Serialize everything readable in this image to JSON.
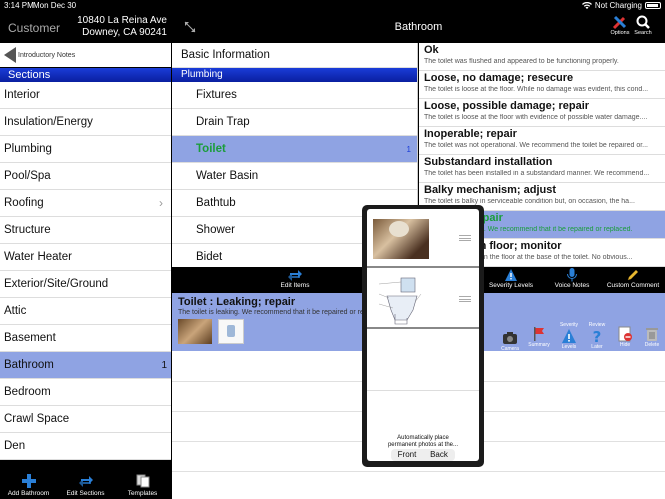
{
  "status": {
    "time": "3:14 PM",
    "date": "Mon Dec 30",
    "charging": "Not Charging"
  },
  "left": {
    "customer": "Customer",
    "address_line1": "10840 La Reina Ave",
    "address_line2": "Downey, CA 90241",
    "intro_notes": "Introductory Notes",
    "sections_header": "Sections",
    "sections": [
      "Interior",
      "Insulation/Energy",
      "Plumbing",
      "Pool/Spa",
      "Roofing",
      "Structure",
      "Water Heater",
      "Exterior/Site/Ground",
      "Attic",
      "Basement",
      "Bathroom",
      "Bedroom",
      "Crawl Space",
      "Den"
    ],
    "bathroom_count": "1",
    "toolbar": {
      "add": "Add Bathroom",
      "edit": "Edit Sections",
      "templates": "Templates"
    }
  },
  "header": {
    "title": "Bathroom",
    "options": "Options",
    "search": "Search"
  },
  "subsections": {
    "basic_info": "Basic Information",
    "group": "Plumbing",
    "items": [
      "Fixtures",
      "Drain Trap",
      "Toilet",
      "Water Basin",
      "Bathtub",
      "Shower",
      "Bidet"
    ],
    "toilet_count": "1"
  },
  "comments": [
    {
      "title": "Ok",
      "desc": "The toilet was flushed and appeared to be functioning properly."
    },
    {
      "title": "Loose, no damage; resecure",
      "desc": "The toilet is loose at the floor. While no damage was evident, this cond..."
    },
    {
      "title": "Loose, possible damage; repair",
      "desc": "The toilet is loose at the floor with evidence of possible water damage...."
    },
    {
      "title": "Inoperable; repair",
      "desc": "The toilet was not operational. We recommend the toilet be repaired or..."
    },
    {
      "title": "Substandard installation",
      "desc": "The toilet has been installed in a substandard manner. We recommend..."
    },
    {
      "title": "Balky mechanism; adjust",
      "desc": "The toilet is balky in serviceable condition but, on occasion, the ha..."
    },
    {
      "title": "Leaking; repair",
      "desc": "The toilet is leaking. We recommend that it be repaired or replaced."
    },
    {
      "title": "Moisture on floor; monitor",
      "desc": "There is moisture on the floor at the base of the toilet. No obvious..."
    }
  ],
  "mid_toolbar": {
    "edit_items": "Edit Items",
    "severity": "Severity Levels",
    "voice": "Voice Notes",
    "custom": "Custom Comment"
  },
  "detail": {
    "title": "Toilet : Leaking; repair",
    "desc": "The toilet is leaking. We recommend that it be repaired or replaced."
  },
  "actions": {
    "camera": "Camera",
    "summary": "Summary",
    "severity_top": "Severity",
    "levels": "Levels",
    "review_top": "Review",
    "later": "Later",
    "hide": "Hide",
    "delete": "Delete"
  },
  "popup": {
    "auto_text_1": "Automatically place",
    "auto_text_2": "permanent photos at the...",
    "front": "Front",
    "back": "Back"
  },
  "colors": {
    "selected": "#8fa3e3",
    "header_blue": "#1a3cd8",
    "selected_text": "#1a9d3a"
  }
}
